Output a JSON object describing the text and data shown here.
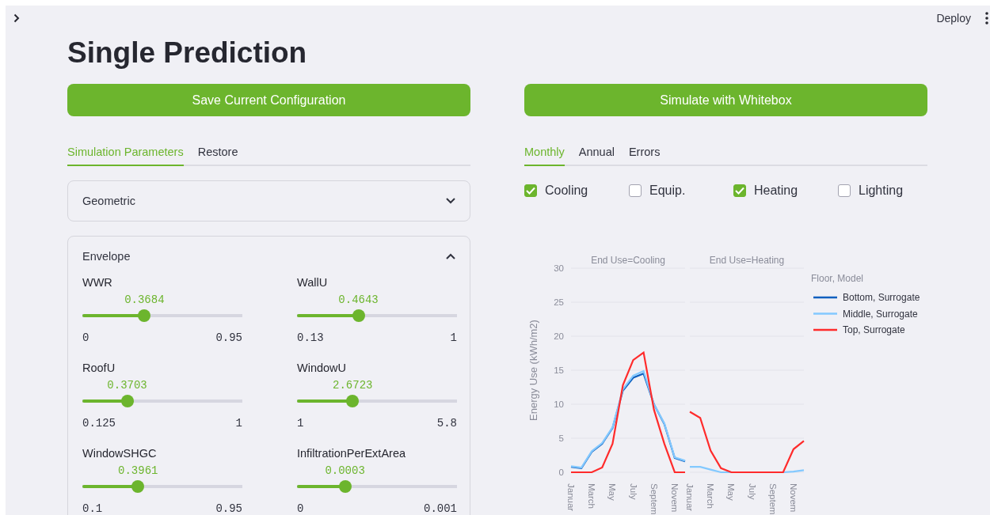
{
  "header": {
    "deploy": "Deploy"
  },
  "title": "Single Prediction",
  "left": {
    "button": "Save Current Configuration",
    "tabs": [
      {
        "label": "Simulation Parameters",
        "selected": true
      },
      {
        "label": "Restore",
        "selected": false
      }
    ],
    "sections": [
      {
        "title": "Geometric",
        "expanded": false
      },
      {
        "title": "Envelope",
        "expanded": true,
        "sliders": [
          {
            "label": "WWR",
            "value": "0.3684",
            "min": "0",
            "max": "0.95",
            "level": 0.388
          },
          {
            "label": "WallU",
            "value": "0.4643",
            "min": "0.13",
            "max": "1",
            "level": 0.384
          },
          {
            "label": "RoofU",
            "value": "0.3703",
            "min": "0.125",
            "max": "1",
            "level": 0.28
          },
          {
            "label": "WindowU",
            "value": "2.6723",
            "min": "1",
            "max": "5.8",
            "level": 0.348
          },
          {
            "label": "WindowSHGC",
            "value": "0.3961",
            "min": "0.1",
            "max": "0.95",
            "level": 0.348
          },
          {
            "label": "InfiltrationPerExtArea",
            "value": "0.0003",
            "min": "0",
            "max": "0.001",
            "level": 0.3
          }
        ]
      }
    ]
  },
  "right": {
    "button": "Simulate with Whitebox",
    "tabs": [
      {
        "label": "Monthly",
        "selected": true
      },
      {
        "label": "Annual",
        "selected": false
      },
      {
        "label": "Errors",
        "selected": false
      }
    ],
    "filters": [
      {
        "label": "Cooling",
        "checked": true
      },
      {
        "label": "Equip.",
        "checked": false
      },
      {
        "label": "Heating",
        "checked": true
      },
      {
        "label": "Lighting",
        "checked": false
      }
    ],
    "legend_title": "Floor, Model",
    "charts": [
      {
        "chart_data": {
          "type": "line",
          "title": "End Use=Cooling",
          "ylabel": "Energy Use (kWh/m2)",
          "grid": true,
          "categories": [
            "Januar",
            null,
            "March",
            null,
            "May",
            null,
            "July",
            null,
            "Septem",
            null,
            "Novem",
            null
          ],
          "ylim": [
            0,
            30
          ],
          "yticks": [
            0,
            5,
            10,
            15,
            20,
            25,
            30
          ],
          "series": [
            {
              "name": "Bottom, Surrogate",
              "color": "#0d5fbf",
              "values": [
                0.8,
                0.6,
                3.0,
                4.2,
                6.5,
                12,
                13.9,
                14.5,
                10,
                7.1,
                2.1,
                1.6
              ]
            },
            {
              "name": "Middle, Surrogate",
              "color": "#83c9ff",
              "values": [
                0.9,
                0.7,
                3.1,
                4.3,
                6.6,
                12.2,
                14.2,
                14.9,
                10,
                7.2,
                2.2,
                1.7
              ]
            },
            {
              "name": "Top, Surrogate",
              "color": "#ff2b2b",
              "values": [
                0,
                0,
                0,
                0.7,
                4.2,
                12.8,
                16.5,
                17.6,
                9.2,
                4.2,
                0,
                0
              ]
            }
          ]
        }
      },
      {
        "chart_data": {
          "type": "line",
          "title": "End Use=Heating",
          "grid": true,
          "categories": [
            "Januar",
            null,
            "March",
            null,
            "May",
            null,
            "July",
            null,
            "Septem",
            null,
            "Novem",
            null
          ],
          "ylim": [
            0,
            30
          ],
          "series": [
            {
              "color": "#83c9ff",
              "values": [
                0.8,
                0.8,
                0.4,
                0,
                0,
                0,
                0,
                0,
                0,
                0,
                0.1,
                0.3
              ]
            },
            {
              "color": "#ff2b2b",
              "values": [
                8.9,
                8.0,
                3.2,
                0.6,
                0,
                0,
                0,
                0,
                0,
                0,
                3.4,
                4.6
              ]
            }
          ]
        }
      }
    ]
  }
}
